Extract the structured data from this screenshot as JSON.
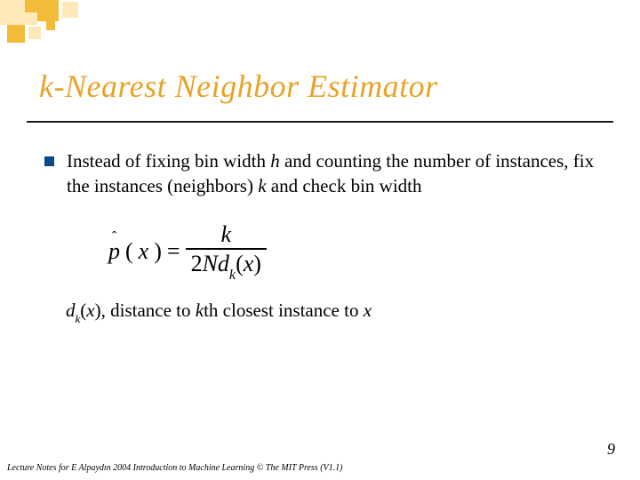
{
  "title": "k-Nearest Neighbor Estimator",
  "bullet": {
    "pre": "Instead of fixing bin width ",
    "h": "h",
    "mid1": " and counting the number of instances, fix the instances (neighbors) ",
    "k": "k",
    "post": " and check bin width"
  },
  "formula": {
    "p": "p",
    "hat": "ˆ",
    "arg_open": "(",
    "x": "x",
    "arg_close": ")",
    "eq": "=",
    "num": "k",
    "den_pre": "2",
    "den_N": "N",
    "den_d": "d",
    "den_k": "k",
    "den_open": "(",
    "den_x": "x",
    "den_close": ")"
  },
  "explain": {
    "d": "d",
    "k": "k",
    "open": "(",
    "x": "x",
    "close": ")",
    "mid": ", distance to ",
    "kth": "k",
    "post": "th closest instance to ",
    "x2": "x"
  },
  "footer": "Lecture Notes for E Alpaydın 2004 Introduction to Machine Learning © The MIT Press (V1.1)",
  "page": "9"
}
